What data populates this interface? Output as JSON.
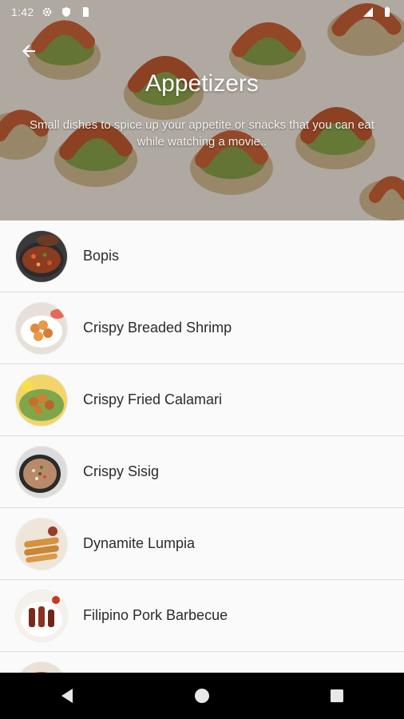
{
  "status_bar": {
    "time": "1:42",
    "icons": [
      "settings-icon",
      "shield-icon",
      "sim-icon",
      "signal-icon",
      "battery-icon"
    ]
  },
  "header": {
    "back_icon": "arrow-back-icon",
    "title": "Appetizers",
    "subtitle": "Small dishes to spice up your appetite or snacks that you can eat while watching a movie.."
  },
  "recipes": [
    {
      "name": "Bopis",
      "thumb_icon": "bopis-thumbnail"
    },
    {
      "name": "Crispy Breaded Shrimp",
      "thumb_icon": "crispy-breaded-shrimp-thumbnail"
    },
    {
      "name": "Crispy Fried Calamari",
      "thumb_icon": "crispy-fried-calamari-thumbnail"
    },
    {
      "name": "Crispy Sisig",
      "thumb_icon": "crispy-sisig-thumbnail"
    },
    {
      "name": "Dynamite Lumpia",
      "thumb_icon": "dynamite-lumpia-thumbnail"
    },
    {
      "name": "Filipino Pork Barbecue",
      "thumb_icon": "filipino-pork-barbecue-thumbnail"
    },
    {
      "name": "",
      "thumb_icon": "next-recipe-thumbnail"
    }
  ],
  "nav_bar": {
    "icons": [
      "back-triangle-icon",
      "home-circle-icon",
      "recents-square-icon"
    ]
  },
  "colors": {
    "background": "#fafafa",
    "divider": "#dcdcdc",
    "text": "#2b2b2b",
    "title_text": "#ffffff",
    "nav_bar": "#000000"
  }
}
